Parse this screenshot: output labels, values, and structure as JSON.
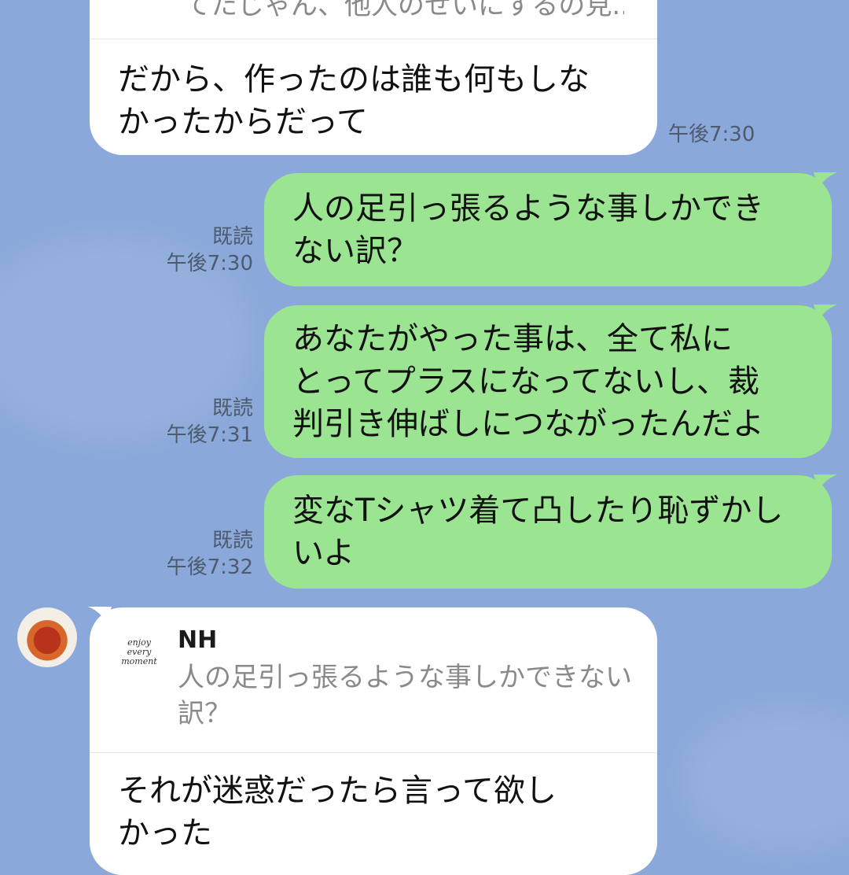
{
  "chat": {
    "top_fragment": "てたじゃん、他人のせいにするの見...",
    "messages": [
      {
        "side": "incoming",
        "text": "だから、作ったのは誰も何もしな\nかったからだって",
        "time": "午後7:30"
      },
      {
        "side": "outgoing",
        "text": "人の足引っ張るような事しかでき\nない訳？",
        "read": "既読",
        "time": "午後7:30"
      },
      {
        "side": "outgoing",
        "text": "あなたがやった事は、全て私に\nとってプラスになってないし、裁\n判引き伸ばしにつながったんだよ",
        "read": "既読",
        "time": "午後7:31"
      },
      {
        "side": "outgoing",
        "text": "変なTシャツ着て凸したり恥ずかし\nいよ",
        "read": "既読",
        "time": "午後7:32"
      }
    ],
    "reply_message": {
      "quoted_name": "NH",
      "quoted_thumb_text": "enjoy\nevery\nmoment",
      "quoted_text": "人の足引っ張るような事しかできない\n訳？",
      "text": "それが迷惑だったら言って欲し\nかった"
    }
  },
  "colors": {
    "background": "#8aa8d9",
    "incoming_bubble": "#ffffff",
    "outgoing_bubble": "#9be492",
    "meta_text": "#4e5a6e"
  }
}
